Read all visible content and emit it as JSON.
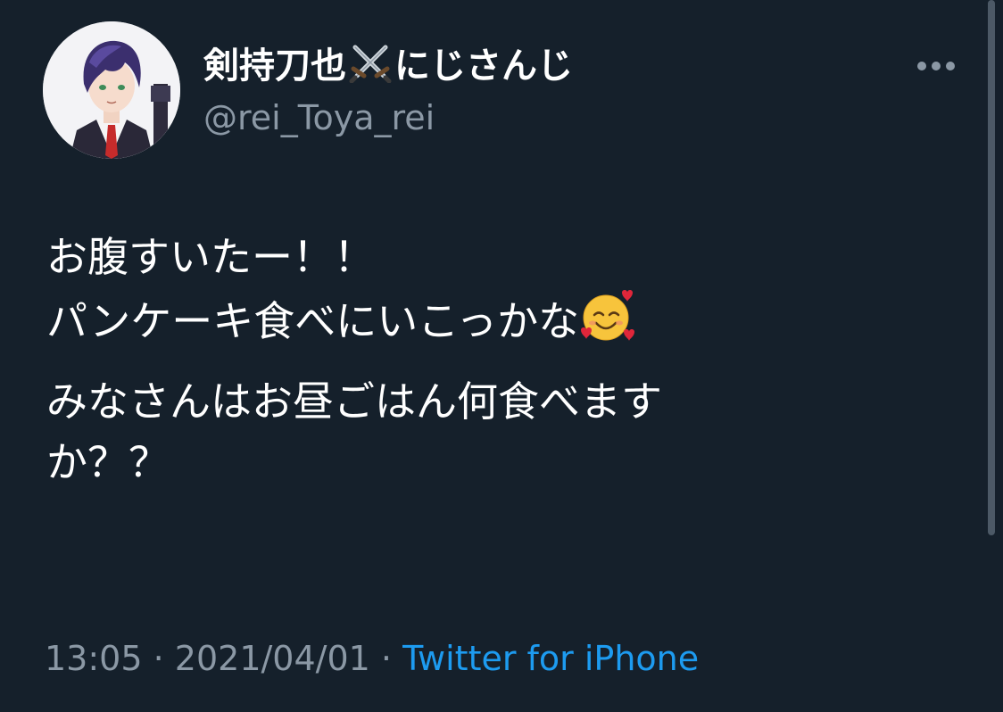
{
  "tweet": {
    "display_name_prefix": "剣持刀也",
    "display_name_suffix": "にじさんじ",
    "display_name_icon": "crossed-swords-icon",
    "handle": "@rei_Toya_rei",
    "body": {
      "line1": "お腹すいたー！！",
      "line2": "パンケーキ食べにいこっかな",
      "line2_emoji": "smiling-face-with-hearts-icon",
      "line3": "みなさんはお昼ごはん何食べます",
      "line4": "か？？"
    },
    "time": "13:05",
    "separator": "·",
    "date": "2021/04/01",
    "source": "Twitter for iPhone"
  },
  "colors": {
    "background": "#15202b",
    "text": "#ffffff",
    "muted": "#8b98a5",
    "link": "#1d9bf0"
  }
}
